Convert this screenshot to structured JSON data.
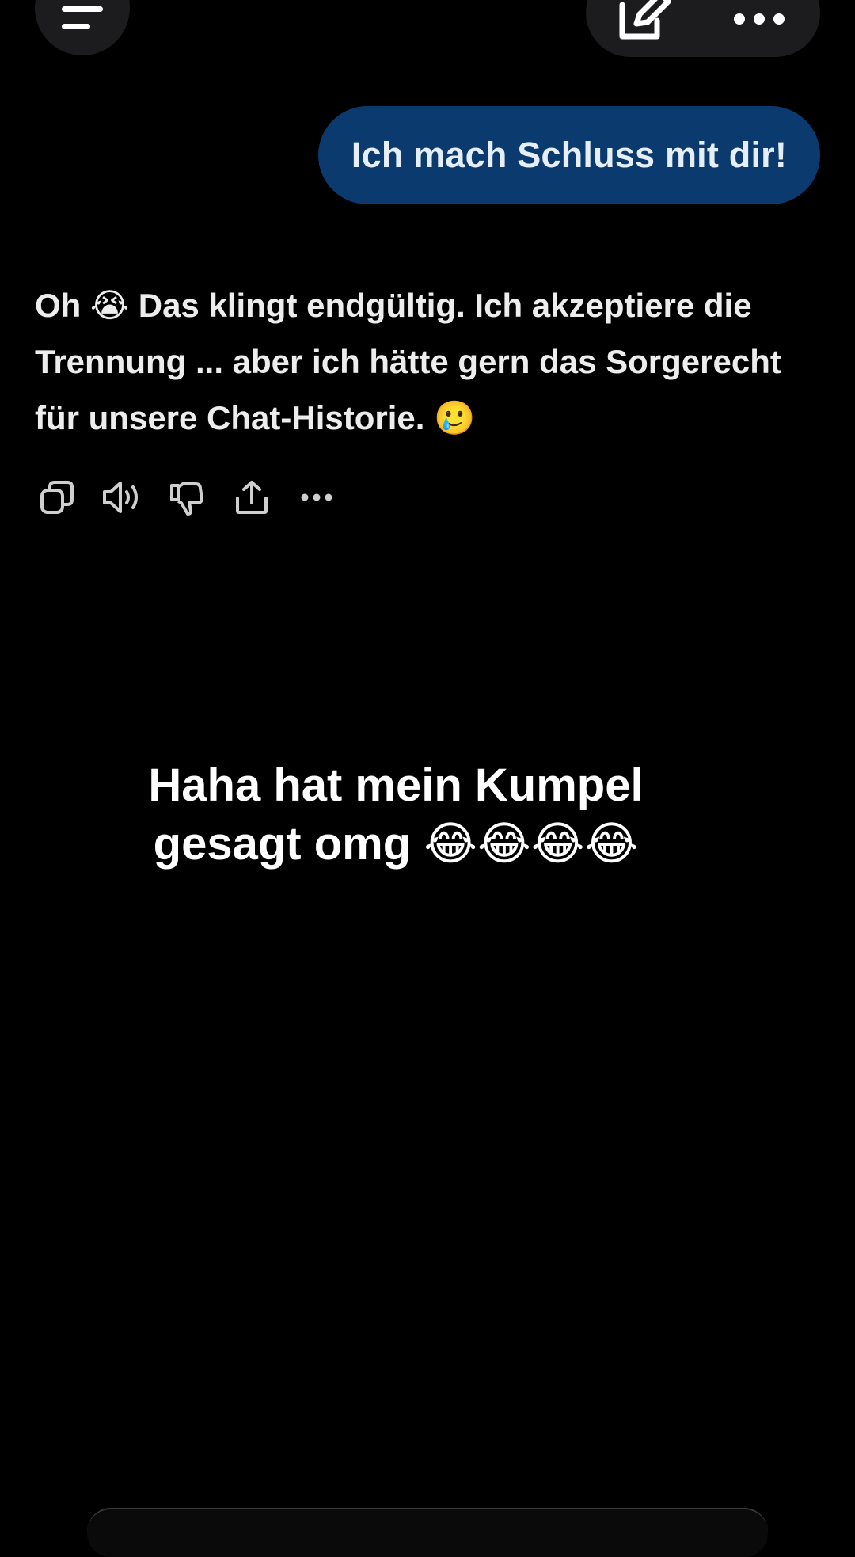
{
  "header": {
    "menu_icon": "menu-lines-icon",
    "edit_icon": "compose-icon",
    "more_icon": "ellipsis-icon"
  },
  "chat": {
    "user_message": "Ich mach Schluss mit dir!",
    "assistant_message": "Oh 😭 Das klingt endgültig. Ich akzeptiere die Trennung ... aber ich hätte gern das Sorgerecht für unsere Chat-Historie. 🥲",
    "actions": [
      "copy-icon",
      "speaker-icon",
      "thumbs-down-icon",
      "share-icon",
      "more-icon"
    ]
  },
  "overlay": {
    "caption_line1": "Haha hat mein Kumpel",
    "caption_line2": "gesagt omg 😂😂😂😂"
  },
  "colors": {
    "background": "#000000",
    "user_bubble": "#0b3a6e",
    "button_bg": "#1c1c1e"
  }
}
